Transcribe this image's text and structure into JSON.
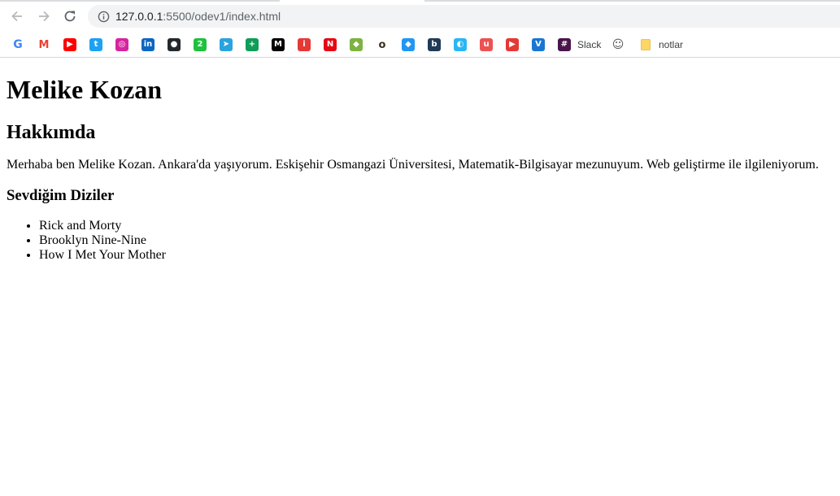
{
  "browser": {
    "url_host": "127.0.0.1",
    "url_rest": ":5500/odev1/index.html",
    "bookmarks": [
      {
        "name": "google",
        "icon": "google-icon",
        "letter": "G",
        "color": "#4285f4",
        "label": ""
      },
      {
        "name": "gmail",
        "icon": "gmail-icon",
        "letter": "M",
        "color": "#ea4335",
        "label": ""
      },
      {
        "name": "youtube",
        "icon": "youtube-icon",
        "letter": "▶",
        "color": "#ff0000",
        "label": ""
      },
      {
        "name": "twitter",
        "icon": "twitter-icon",
        "letter": "t",
        "color": "#1da1f2",
        "label": ""
      },
      {
        "name": "instagram",
        "icon": "instagram-icon",
        "letter": "◎",
        "color": "#d6249f",
        "label": ""
      },
      {
        "name": "linkedin",
        "icon": "linkedin-icon",
        "letter": "in",
        "color": "#0a66c2",
        "label": ""
      },
      {
        "name": "github",
        "icon": "github-icon",
        "letter": "●",
        "color": "#24292e",
        "label": ""
      },
      {
        "name": "bookmark-2",
        "icon": "two-badge-icon",
        "letter": "2",
        "color": "#1ec23c",
        "label": ""
      },
      {
        "name": "telegram",
        "icon": "telegram-icon",
        "letter": "➤",
        "color": "#2aa3df",
        "label": ""
      },
      {
        "name": "trello",
        "icon": "plus-tile-icon",
        "letter": "+",
        "color": "#0f9d58",
        "label": ""
      },
      {
        "name": "medium",
        "icon": "medium-icon",
        "letter": "M",
        "color": "#000000",
        "label": ""
      },
      {
        "name": "item-red",
        "icon": "red-book-icon",
        "letter": "i",
        "color": "#e53935",
        "label": ""
      },
      {
        "name": "netflix",
        "icon": "netflix-icon",
        "letter": "N",
        "color": "#e50914",
        "label": ""
      },
      {
        "name": "codepen",
        "icon": "code-icon",
        "letter": "◆",
        "color": "#7cb342",
        "label": ""
      },
      {
        "name": "goodreads",
        "icon": "goodreads-icon",
        "letter": "o",
        "color": "#3b2e1f",
        "label": ""
      },
      {
        "name": "stackedit",
        "icon": "stackedit-icon",
        "letter": "◆",
        "color": "#2196f3",
        "label": ""
      },
      {
        "name": "bitbucket",
        "icon": "bb-icon",
        "letter": "b",
        "color": "#1f3b57",
        "label": ""
      },
      {
        "name": "semrush",
        "icon": "semrush-icon",
        "letter": "◐",
        "color": "#29b6f6",
        "label": ""
      },
      {
        "name": "udemy",
        "icon": "udemy-icon",
        "letter": "u",
        "color": "#ec5252",
        "label": ""
      },
      {
        "name": "play-red",
        "icon": "play-icon",
        "letter": "▶",
        "color": "#e53935",
        "label": ""
      },
      {
        "name": "vuetify",
        "icon": "v-icon",
        "letter": "V",
        "color": "#1976d2",
        "label": ""
      },
      {
        "name": "slack",
        "icon": "slack-icon",
        "letter": "#",
        "color": "#4a154b",
        "label": "Slack"
      },
      {
        "name": "avatar-bookmark",
        "icon": "person-sketch-icon",
        "letter": "☺",
        "color": "#9e9e9e",
        "label": ""
      },
      {
        "name": "notlar",
        "icon": "folder-icon",
        "letter": "",
        "color": "#fdd663",
        "label": "notlar"
      }
    ]
  },
  "page": {
    "title": "Melike Kozan",
    "about_heading": "Hakkımda",
    "about_text": "Merhaba ben Melike Kozan. Ankara'da yaşıyorum. Eskişehir Osmangazi Üniversitesi, Matematik-Bilgisayar mezunuyum. Web geliştirme ile ilgileniyorum.",
    "series_heading": "Sevdiğim Diziler",
    "series": [
      "Rick and Morty",
      "Brooklyn Nine-Nine",
      "How I Met Your Mother"
    ]
  }
}
